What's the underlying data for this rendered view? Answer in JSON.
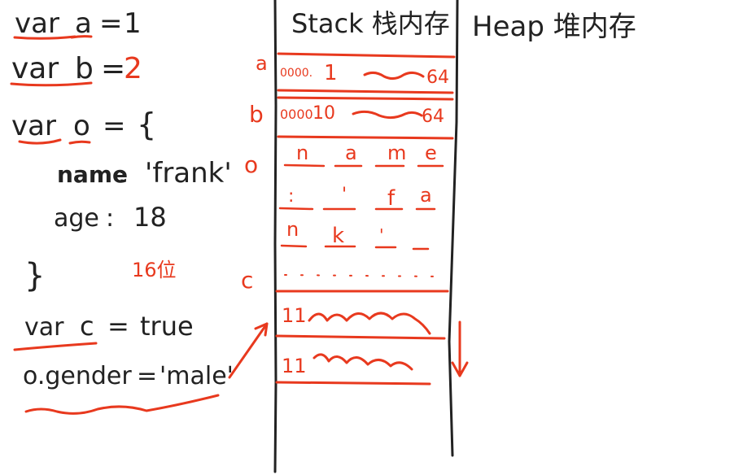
{
  "code": {
    "line_a": {
      "keyword": "var",
      "name": "a",
      "op": "=",
      "value": "1"
    },
    "line_b": {
      "keyword": "var",
      "name": "b",
      "op": "=",
      "value": "2"
    },
    "line_o": {
      "keyword": "var",
      "name": "o",
      "op": "=",
      "brace_open": "{"
    },
    "prop_name": {
      "key": "name",
      "colon": ":",
      "value": "'frank'"
    },
    "prop_age": {
      "key": "age",
      "colon": ":",
      "value": "18"
    },
    "brace_close": "}",
    "line_c": {
      "keyword": "var",
      "name": "c",
      "op": "=",
      "value": "true"
    },
    "line_assign": {
      "lhs": "o.gender",
      "op": "=",
      "value": "'male'"
    }
  },
  "annotations": {
    "bits_note": "16位"
  },
  "memory": {
    "stack_title": "Stack 栈内存",
    "heap_title": "Heap 堆内存",
    "labels": {
      "a": "a",
      "b": "b",
      "o": "o",
      "c": "c"
    },
    "stack_rows": {
      "a_row": {
        "prefix": "0000.",
        "value": "1",
        "suffix": "64"
      },
      "b_row": {
        "prefix": "0000",
        "value": "10",
        "suffix": "64"
      },
      "o_row1": [
        "n",
        "a",
        "m",
        "e"
      ],
      "o_row2": [
        ":",
        "'",
        "f",
        "a"
      ],
      "o_row3": [
        "n",
        "k",
        "'",
        ""
      ],
      "c_row1_prefix": "11",
      "c_row2_prefix": "11"
    }
  },
  "colors": {
    "ink": "#222222",
    "accent": "#e8391e",
    "background": "#ffffff"
  }
}
